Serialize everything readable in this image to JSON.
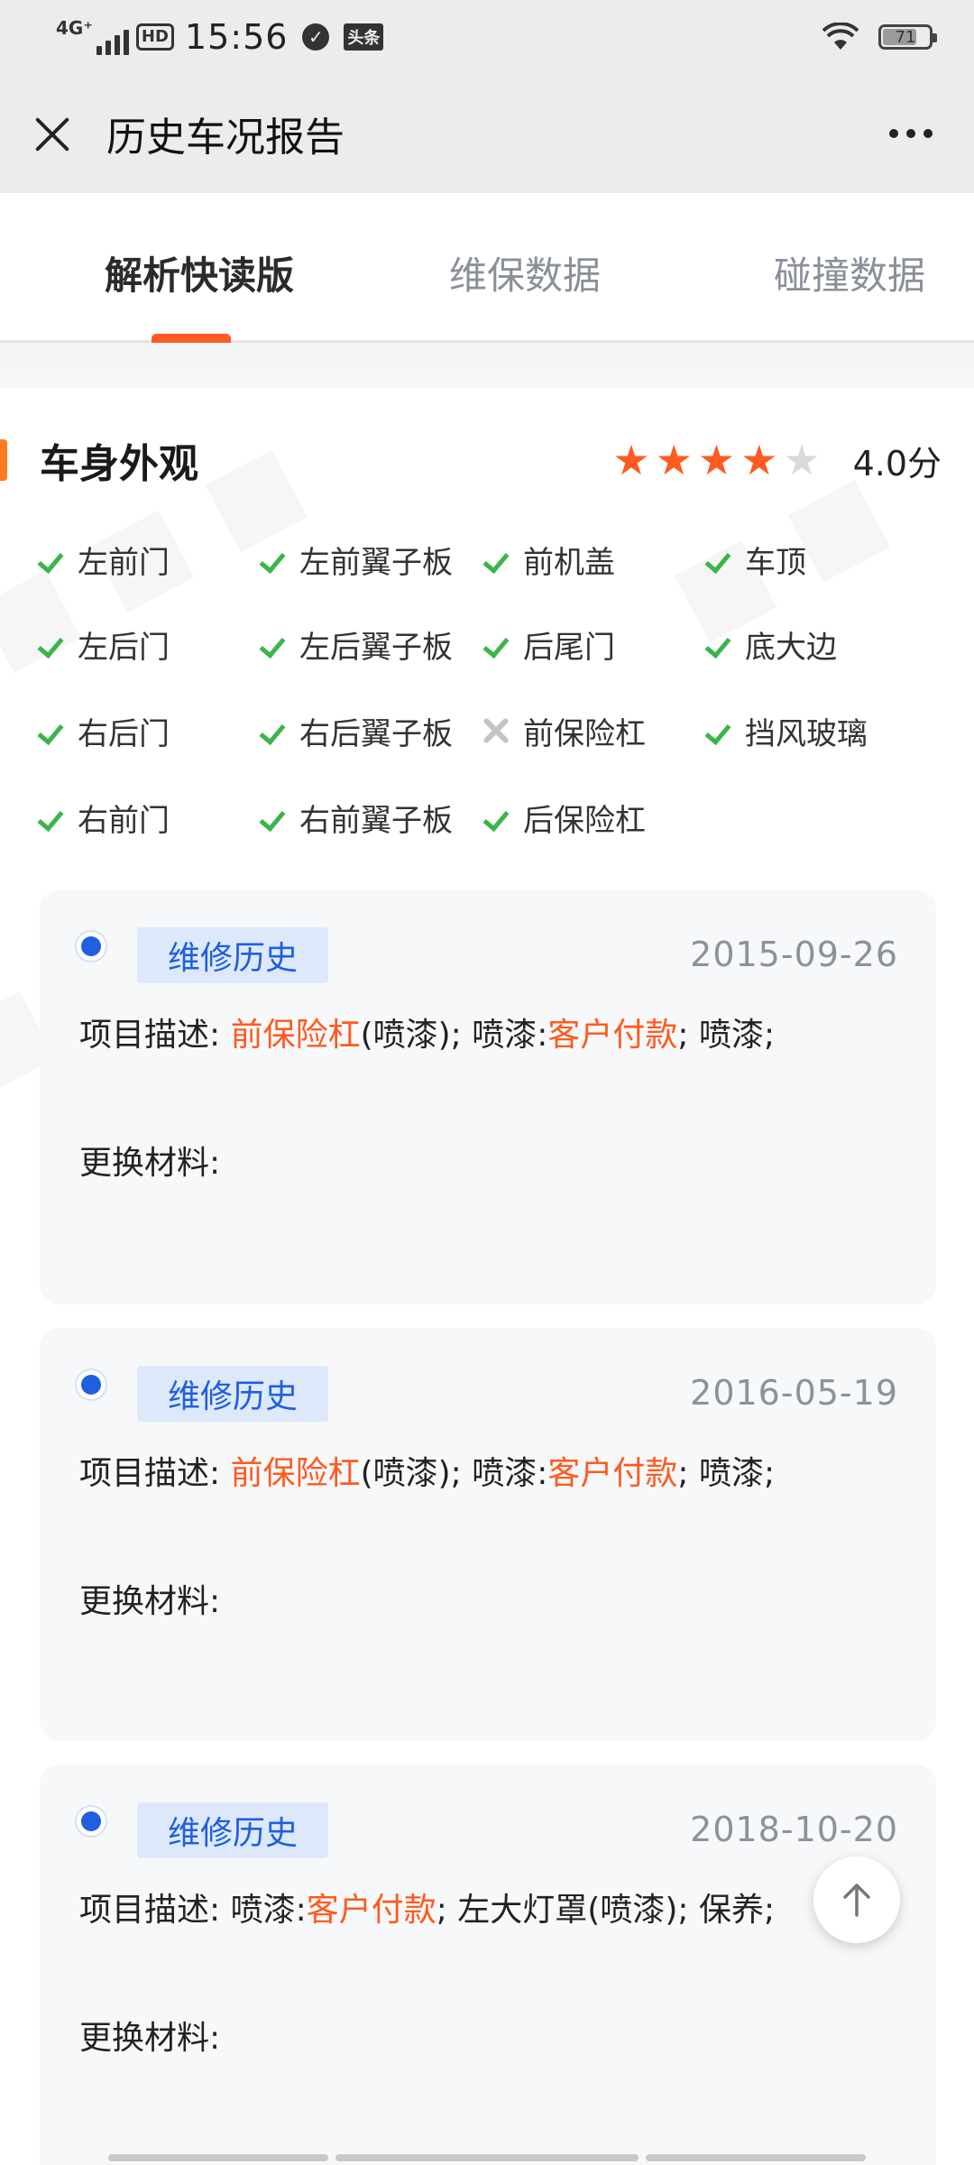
{
  "status_bar": {
    "network": "4G⁺",
    "hd": "HD",
    "time": "15:56",
    "app_badge": "头条",
    "battery": "71"
  },
  "title_bar": {
    "title": "历史车况报告"
  },
  "tabs": [
    {
      "label": "解析快读版",
      "active": true
    },
    {
      "label": "维保数据",
      "active": false
    },
    {
      "label": "碰撞数据",
      "active": false
    }
  ],
  "section": {
    "title": "车身外观",
    "rating_stars": 4,
    "rating_max": 5,
    "score": "4.0分"
  },
  "parts": [
    {
      "label": "左前门",
      "status": "ok"
    },
    {
      "label": "左前翼子板",
      "status": "ok"
    },
    {
      "label": "前机盖",
      "status": "ok"
    },
    {
      "label": "车顶",
      "status": "ok"
    },
    {
      "label": "左后门",
      "status": "ok"
    },
    {
      "label": "左后翼子板",
      "status": "ok"
    },
    {
      "label": "后尾门",
      "status": "ok"
    },
    {
      "label": "底大边",
      "status": "ok"
    },
    {
      "label": "右后门",
      "status": "ok"
    },
    {
      "label": "右后翼子板",
      "status": "ok"
    },
    {
      "label": "前保险杠",
      "status": "repair"
    },
    {
      "label": "挡风玻璃",
      "status": "ok"
    },
    {
      "label": "右前门",
      "status": "ok"
    },
    {
      "label": "右前翼子板",
      "status": "ok"
    },
    {
      "label": "后保险杠",
      "status": "ok"
    }
  ],
  "records": [
    {
      "tag": "维修历史",
      "date": "2015-09-26",
      "desc": [
        {
          "t": "项目描述: ",
          "hl": false
        },
        {
          "t": "前保险杠",
          "hl": true
        },
        {
          "t": "(喷漆); 喷漆:",
          "hl": false
        },
        {
          "t": "客户付款",
          "hl": true
        },
        {
          "t": "; 喷漆;",
          "hl": false
        }
      ],
      "materials": "更换材料:"
    },
    {
      "tag": "维修历史",
      "date": "2016-05-19",
      "desc": [
        {
          "t": "项目描述: ",
          "hl": false
        },
        {
          "t": "前保险杠",
          "hl": true
        },
        {
          "t": "(喷漆); 喷漆:",
          "hl": false
        },
        {
          "t": "客户付款",
          "hl": true
        },
        {
          "t": "; 喷漆;",
          "hl": false
        }
      ],
      "materials": "更换材料:"
    },
    {
      "tag": "维修历史",
      "date": "2018-10-20",
      "desc": [
        {
          "t": "项目描述: 喷漆:",
          "hl": false
        },
        {
          "t": "客户付款",
          "hl": true
        },
        {
          "t": "; 左大灯罩(喷漆); 保养;",
          "hl": false
        }
      ],
      "materials": "更换材料:"
    }
  ],
  "colors": {
    "accent": "#ff5a1f",
    "check": "#3bb54a",
    "tag_blue": "#1f5fe0",
    "tag_bg": "#dde9fb"
  },
  "icons": {
    "close": "close-icon",
    "more": "more-icon",
    "ok": "check-icon",
    "repair": "wrench-icon",
    "to_top": "arrow-up-icon"
  }
}
